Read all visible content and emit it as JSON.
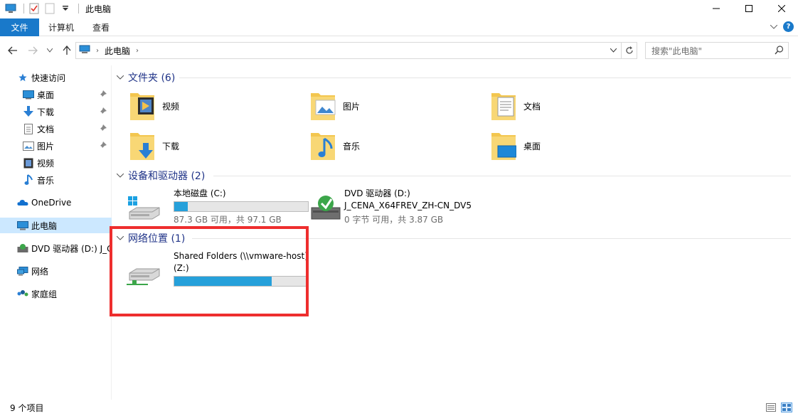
{
  "window": {
    "title": "此电脑"
  },
  "ribbon": {
    "tabs": [
      "文件",
      "计算机",
      "查看"
    ]
  },
  "address": {
    "crumbs": [
      "此电脑"
    ]
  },
  "search": {
    "placeholder": "搜索\"此电脑\""
  },
  "sidebar": {
    "items": [
      {
        "label": "快速访问",
        "icon": "star-icon"
      },
      {
        "label": "桌面",
        "icon": "desktop-icon",
        "pinned": true
      },
      {
        "label": "下载",
        "icon": "download-icon",
        "pinned": true
      },
      {
        "label": "文档",
        "icon": "document-icon",
        "pinned": true
      },
      {
        "label": "图片",
        "icon": "picture-icon",
        "pinned": true
      },
      {
        "label": "视频",
        "icon": "video-icon"
      },
      {
        "label": "音乐",
        "icon": "music-icon"
      },
      {
        "label": "OneDrive",
        "icon": "cloud-icon"
      },
      {
        "label": "此电脑",
        "icon": "computer-icon",
        "selected": true
      },
      {
        "label": "DVD 驱动器 (D:) J_C",
        "icon": "dvd-icon"
      },
      {
        "label": "网络",
        "icon": "network-icon"
      },
      {
        "label": "家庭组",
        "icon": "homegroup-icon"
      }
    ]
  },
  "groups": {
    "folders": {
      "header": "文件夹 (6)",
      "items": [
        {
          "label": "视频",
          "icon": "video-folder-icon"
        },
        {
          "label": "图片",
          "icon": "picture-folder-icon"
        },
        {
          "label": "文档",
          "icon": "document-folder-icon"
        },
        {
          "label": "下载",
          "icon": "download-folder-icon"
        },
        {
          "label": "音乐",
          "icon": "music-folder-icon"
        },
        {
          "label": "桌面",
          "icon": "desktop-folder-icon"
        }
      ]
    },
    "devices": {
      "header": "设备和驱动器 (2)",
      "items": [
        {
          "name": "本地磁盘 (C:)",
          "sub": "87.3 GB 可用，共 97.1 GB",
          "used_fraction": 0.1,
          "icon": "local-disk-icon"
        },
        {
          "name": "DVD 驱动器 (D:)",
          "name2": "J_CENA_X64FREV_ZH-CN_DV5",
          "sub": "0 字节 可用，共 3.87 GB",
          "icon": "dvd-drive-icon"
        }
      ]
    },
    "network": {
      "header": "网络位置 (1)",
      "items": [
        {
          "name": "Shared Folders (\\\\vmware-host)",
          "name2": "(Z:)",
          "used_fraction": 0.73,
          "icon": "network-drive-icon"
        }
      ]
    }
  },
  "status": {
    "count": "9 个项目"
  },
  "colors": {
    "accent": "#1979ca",
    "bar_fill": "#26a0da",
    "highlight": "#ee2e2e"
  }
}
